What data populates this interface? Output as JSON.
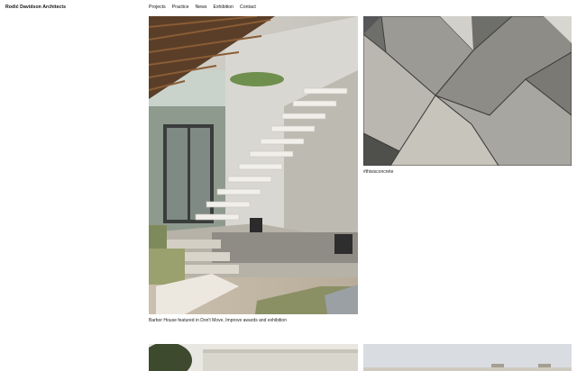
{
  "header": {
    "logo": "Rodić Davidson Architects",
    "nav": [
      {
        "label": "Projects"
      },
      {
        "label": "Practice"
      },
      {
        "label": "News"
      },
      {
        "label": "Exhibition"
      },
      {
        "label": "Contact"
      }
    ]
  },
  "feed": {
    "items": [
      {
        "caption": "Barbor House featured in Don't Move, Improve awards and exhibition"
      },
      {
        "caption": "#thisisconcrete"
      }
    ]
  }
}
